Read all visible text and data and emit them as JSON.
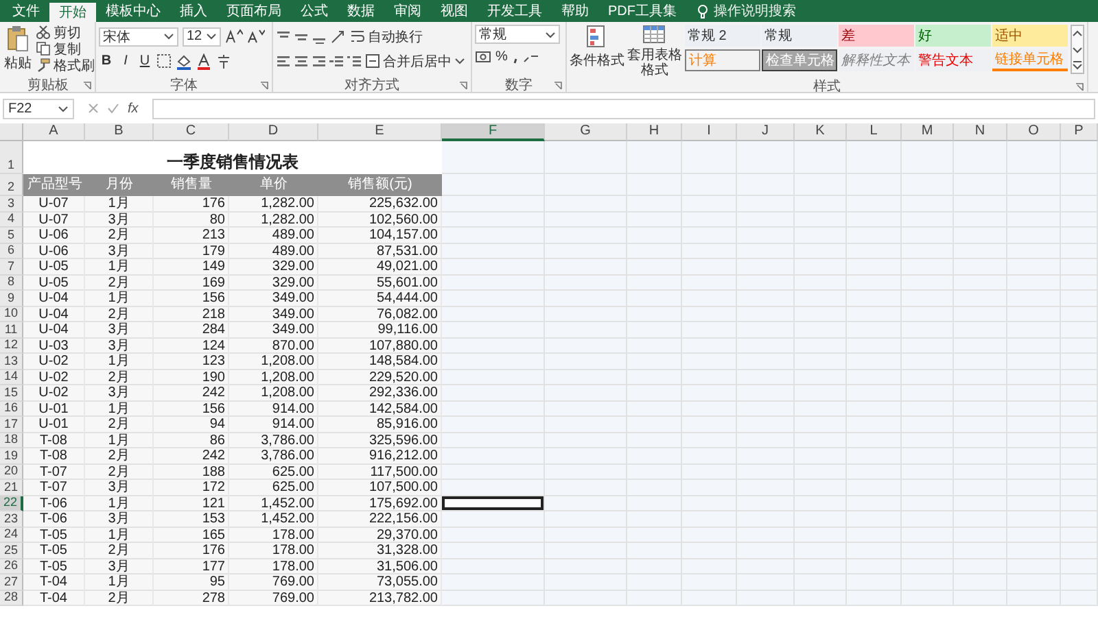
{
  "menu_tabs": [
    {
      "label": "文件",
      "selected": false
    },
    {
      "label": "开始",
      "selected": true
    },
    {
      "label": "模板中心",
      "selected": false
    },
    {
      "label": "插入",
      "selected": false
    },
    {
      "label": "页面布局",
      "selected": false
    },
    {
      "label": "公式",
      "selected": false
    },
    {
      "label": "数据",
      "selected": false
    },
    {
      "label": "审阅",
      "selected": false
    },
    {
      "label": "视图",
      "selected": false
    },
    {
      "label": "开发工具",
      "selected": false
    },
    {
      "label": "帮助",
      "selected": false
    },
    {
      "label": "PDF工具集",
      "selected": false
    }
  ],
  "search": {
    "placeholder": "操作说明搜索"
  },
  "ribbon": {
    "clipboard": {
      "paste": "粘贴",
      "actions": [
        "剪切",
        "复制",
        "格式刷"
      ],
      "label": "剪贴板"
    },
    "font": {
      "name": "宋体",
      "size": "12",
      "styles": [
        "B",
        "I",
        "U"
      ],
      "label": "字体"
    },
    "alignment": {
      "wrap": "自动换行",
      "merge": "合并后居中",
      "label": "对齐方式"
    },
    "number": {
      "format": "常规",
      "percent": "%",
      "label": "数字"
    },
    "styles": {
      "conditional": "条件格式",
      "table_format": "套用表格格式",
      "label": "样式",
      "cells": [
        {
          "label": "常规 2",
          "kind": "normal"
        },
        {
          "label": "常规",
          "kind": "normal"
        },
        {
          "label": "差",
          "kind": "bad"
        },
        {
          "label": "好",
          "kind": "good"
        },
        {
          "label": "适中",
          "kind": "neutral"
        },
        {
          "label": "计算",
          "kind": "calc"
        },
        {
          "label": "检查单元格",
          "kind": "check"
        },
        {
          "label": "解释性文本",
          "kind": "explanatory"
        },
        {
          "label": "警告文本",
          "kind": "warning"
        },
        {
          "label": "链接单元格",
          "kind": "linked"
        }
      ]
    }
  },
  "formula_bar": {
    "name_box": "F22",
    "function_label": "fx"
  },
  "sheet": {
    "columns": [
      {
        "label": "A",
        "selected": false
      },
      {
        "label": "B",
        "selected": false
      },
      {
        "label": "C",
        "selected": false
      },
      {
        "label": "D",
        "selected": false
      },
      {
        "label": "E",
        "selected": false
      },
      {
        "label": "F",
        "selected": true
      },
      {
        "label": "G",
        "selected": false
      },
      {
        "label": "H",
        "selected": false
      },
      {
        "label": "I",
        "selected": false
      },
      {
        "label": "J",
        "selected": false
      },
      {
        "label": "K",
        "selected": false
      },
      {
        "label": "L",
        "selected": false
      },
      {
        "label": "M",
        "selected": false
      },
      {
        "label": "N",
        "selected": false
      },
      {
        "label": "O",
        "selected": false
      },
      {
        "label": "P",
        "selected": false
      }
    ],
    "title_row": {
      "number": "1",
      "title": "一季度销售情况表"
    },
    "header_row": {
      "number": "2",
      "cells": [
        "产品型号",
        "月份",
        "销售量",
        "单价",
        "销售额(元)"
      ]
    },
    "rows": [
      {
        "number": "3",
        "selected": false,
        "cells": [
          "U-07",
          "1月",
          "176",
          "1,282.00",
          "225,632.00"
        ]
      },
      {
        "number": "4",
        "selected": false,
        "cells": [
          "U-07",
          "3月",
          "80",
          "1,282.00",
          "102,560.00"
        ]
      },
      {
        "number": "5",
        "selected": false,
        "cells": [
          "U-06",
          "2月",
          "213",
          "489.00",
          "104,157.00"
        ]
      },
      {
        "number": "6",
        "selected": false,
        "cells": [
          "U-06",
          "3月",
          "179",
          "489.00",
          "87,531.00"
        ]
      },
      {
        "number": "7",
        "selected": false,
        "cells": [
          "U-05",
          "1月",
          "149",
          "329.00",
          "49,021.00"
        ]
      },
      {
        "number": "8",
        "selected": false,
        "cells": [
          "U-05",
          "2月",
          "169",
          "329.00",
          "55,601.00"
        ]
      },
      {
        "number": "9",
        "selected": false,
        "cells": [
          "U-04",
          "1月",
          "156",
          "349.00",
          "54,444.00"
        ]
      },
      {
        "number": "10",
        "selected": false,
        "cells": [
          "U-04",
          "2月",
          "218",
          "349.00",
          "76,082.00"
        ]
      },
      {
        "number": "11",
        "selected": false,
        "cells": [
          "U-04",
          "3月",
          "284",
          "349.00",
          "99,116.00"
        ]
      },
      {
        "number": "12",
        "selected": false,
        "cells": [
          "U-03",
          "3月",
          "124",
          "870.00",
          "107,880.00"
        ]
      },
      {
        "number": "13",
        "selected": false,
        "cells": [
          "U-02",
          "1月",
          "123",
          "1,208.00",
          "148,584.00"
        ]
      },
      {
        "number": "14",
        "selected": false,
        "cells": [
          "U-02",
          "2月",
          "190",
          "1,208.00",
          "229,520.00"
        ]
      },
      {
        "number": "15",
        "selected": false,
        "cells": [
          "U-02",
          "3月",
          "242",
          "1,208.00",
          "292,336.00"
        ]
      },
      {
        "number": "16",
        "selected": false,
        "cells": [
          "U-01",
          "1月",
          "156",
          "914.00",
          "142,584.00"
        ]
      },
      {
        "number": "17",
        "selected": false,
        "cells": [
          "U-01",
          "2月",
          "94",
          "914.00",
          "85,916.00"
        ]
      },
      {
        "number": "18",
        "selected": false,
        "cells": [
          "T-08",
          "1月",
          "86",
          "3,786.00",
          "325,596.00"
        ]
      },
      {
        "number": "19",
        "selected": false,
        "cells": [
          "T-08",
          "2月",
          "242",
          "3,786.00",
          "916,212.00"
        ]
      },
      {
        "number": "20",
        "selected": false,
        "cells": [
          "T-07",
          "2月",
          "188",
          "625.00",
          "117,500.00"
        ]
      },
      {
        "number": "21",
        "selected": false,
        "cells": [
          "T-07",
          "3月",
          "172",
          "625.00",
          "107,500.00"
        ]
      },
      {
        "number": "22",
        "selected": true,
        "cells": [
          "T-06",
          "1月",
          "121",
          "1,452.00",
          "175,692.00"
        ]
      },
      {
        "number": "23",
        "selected": false,
        "cells": [
          "T-06",
          "3月",
          "153",
          "1,452.00",
          "222,156.00"
        ]
      },
      {
        "number": "24",
        "selected": false,
        "cells": [
          "T-05",
          "1月",
          "165",
          "178.00",
          "29,370.00"
        ]
      },
      {
        "number": "25",
        "selected": false,
        "cells": [
          "T-05",
          "2月",
          "176",
          "178.00",
          "31,328.00"
        ]
      },
      {
        "number": "26",
        "selected": false,
        "cells": [
          "T-05",
          "3月",
          "177",
          "178.00",
          "31,506.00"
        ]
      },
      {
        "number": "27",
        "selected": false,
        "cells": [
          "T-04",
          "1月",
          "95",
          "769.00",
          "73,055.00"
        ]
      },
      {
        "number": "28",
        "selected": false,
        "cells": [
          "T-04",
          "2月",
          "278",
          "769.00",
          "213,782.00"
        ]
      }
    ]
  }
}
